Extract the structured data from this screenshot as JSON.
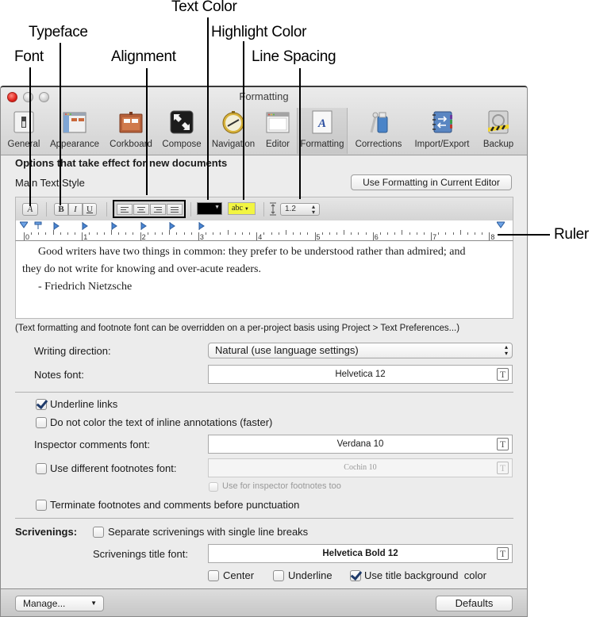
{
  "callouts": {
    "font": "Font",
    "typeface": "Typeface",
    "alignment": "Alignment",
    "text_color": "Text Color",
    "highlight_color": "Highlight Color",
    "line_spacing": "Line Spacing",
    "ruler": "Ruler"
  },
  "window": {
    "title": "Formatting"
  },
  "toolbar": {
    "items": [
      {
        "label": "General",
        "icon": "general-switch-icon"
      },
      {
        "label": "Appearance",
        "icon": "appearance-window-icon"
      },
      {
        "label": "Corkboard",
        "icon": "corkboard-icon"
      },
      {
        "label": "Compose",
        "icon": "compose-fullscreen-icon"
      },
      {
        "label": "Navigation",
        "icon": "navigation-compass-icon"
      },
      {
        "label": "Editor",
        "icon": "editor-window-icon"
      },
      {
        "label": "Formatting",
        "icon": "formatting-document-icon",
        "selected": true
      },
      {
        "label": "Corrections",
        "icon": "corrections-bottle-icon"
      },
      {
        "label": "Import/Export",
        "icon": "import-export-notebook-icon"
      },
      {
        "label": "Backup",
        "icon": "backup-drive-icon"
      }
    ]
  },
  "main": {
    "heading": "Options that take effect for new documents",
    "main_text_style": "Main Text Style",
    "use_formatting_button": "Use Formatting in Current Editor",
    "format_bar": {
      "font_button": "A",
      "bold": "B",
      "italic": "I",
      "underline": "U",
      "text_color": "#000000",
      "highlight_label": "abc",
      "highlight_color": "#f2f542",
      "line_spacing": "1.2"
    },
    "ruler": {
      "numbers": [
        "0",
        "1",
        "2",
        "3",
        "4",
        "5",
        "6",
        "7",
        "8"
      ]
    },
    "sample_text": {
      "line1": "Good writers have two things in common: they prefer to be understood rather than admired; and",
      "line2": "they do not write for knowing and over-acute readers.",
      "line3": "- Friedrich Nietzsche"
    },
    "override_note": "(Text formatting and footnote font can be overridden on a per-project basis using Project > Text Preferences...)",
    "writing_direction_label": "Writing direction:",
    "writing_direction_value": "Natural (use language settings)",
    "notes_font_label": "Notes font:",
    "notes_font_value": "Helvetica 12",
    "underline_links": {
      "label": "Underline links",
      "checked": true
    },
    "no_color_annotations": {
      "label": "Do not color the text of inline annotations (faster)",
      "checked": false
    },
    "inspector_comments_font_label": "Inspector comments font:",
    "inspector_comments_font_value": "Verdana 10",
    "different_footnotes": {
      "label": "Use different footnotes font:",
      "checked": false
    },
    "footnotes_font_value": "Cochin 10",
    "inspector_footnotes_too": {
      "label": "Use for inspector footnotes too",
      "checked": false,
      "disabled": true
    },
    "terminate_footnotes": {
      "label": "Terminate footnotes and comments before punctuation",
      "checked": false
    },
    "scrivenings_label": "Scrivenings:",
    "separate_scrivenings": {
      "label": "Separate scrivenings with single line breaks",
      "checked": false
    },
    "scrivenings_title_font_label": "Scrivenings title font:",
    "scrivenings_title_font_value": "Helvetica Bold 12",
    "center": {
      "label": "Center",
      "checked": false
    },
    "underline": {
      "label": "Underline",
      "checked": false
    },
    "title_background": {
      "label": "Use title background  color",
      "checked": true
    }
  },
  "footer": {
    "manage_button": "Manage...",
    "defaults_button": "Defaults"
  }
}
